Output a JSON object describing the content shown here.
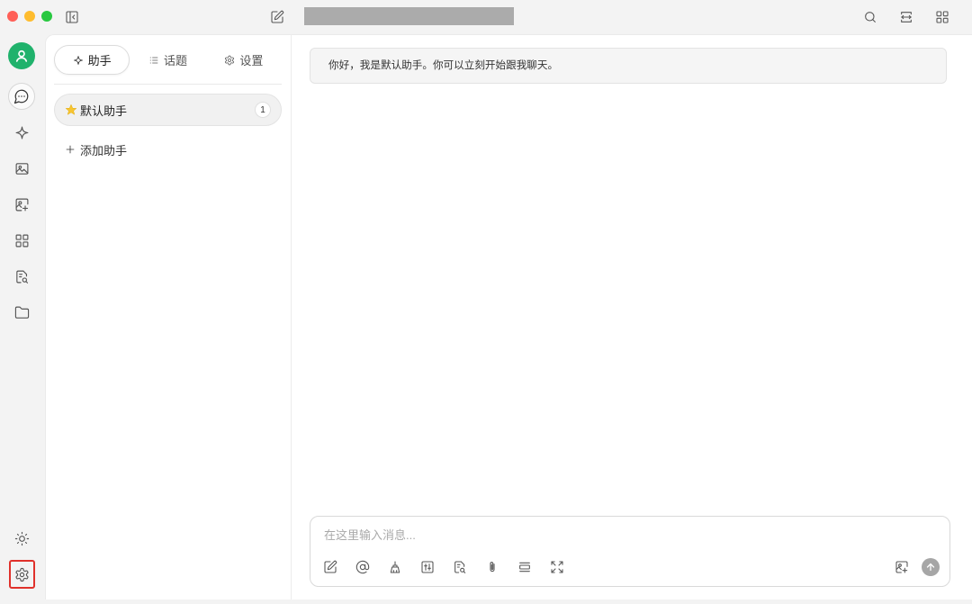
{
  "window": {
    "controls": [
      {
        "name": "close",
        "color": "#ff5f57"
      },
      {
        "name": "minimize",
        "color": "#febc2e"
      },
      {
        "name": "zoom",
        "color": "#28c840"
      }
    ]
  },
  "titlebar": {
    "left_icons": [
      "sidebar-toggle-icon",
      "edit-icon"
    ],
    "right_icons": [
      "search-icon",
      "fit-width-icon",
      "layout-grid-icon"
    ]
  },
  "nav": {
    "avatar": {
      "icon": "user-icon",
      "color": "#20b26c"
    },
    "items": [
      {
        "icon": "chat-bubble-icon",
        "active": true
      },
      {
        "icon": "sparkle-icon",
        "active": false
      },
      {
        "icon": "image-icon",
        "active": false
      },
      {
        "icon": "image-add-icon",
        "active": false
      },
      {
        "icon": "layout-grid-icon",
        "active": false
      },
      {
        "icon": "document-search-icon",
        "active": false
      },
      {
        "icon": "folder-icon",
        "active": false
      }
    ],
    "bottom_items": [
      {
        "icon": "sun-icon",
        "highlighted": false
      },
      {
        "icon": "gear-icon",
        "highlighted": true
      }
    ],
    "highlight_color": "#e0312b"
  },
  "panel": {
    "tabs": [
      {
        "label": "助手",
        "icon": "sparkle-icon",
        "active": true
      },
      {
        "label": "话题",
        "icon": "list-icon",
        "active": false
      },
      {
        "label": "设置",
        "icon": "gear-icon",
        "active": false
      }
    ],
    "assistants": [
      {
        "icon": "star-icon",
        "name": "默认助手",
        "count": 1,
        "selected": true
      }
    ],
    "add_assistant": {
      "icon": "plus-icon",
      "label": "添加助手"
    }
  },
  "chat": {
    "messages": [
      {
        "text": "你好，我是默认助手。你可以立刻开始跟我聊天。"
      }
    ],
    "input": {
      "value": "",
      "placeholder": "在这里输入消息...",
      "tools": [
        "edit-icon",
        "at-sign-icon",
        "broom-icon",
        "sliders-icon",
        "document-search-icon",
        "paperclip-icon",
        "divider-icon",
        "expand-icon"
      ],
      "right_tools": [
        "image-add-icon"
      ],
      "send": {
        "icon": "arrow-up-icon",
        "color": "#a6a6a6"
      }
    }
  }
}
